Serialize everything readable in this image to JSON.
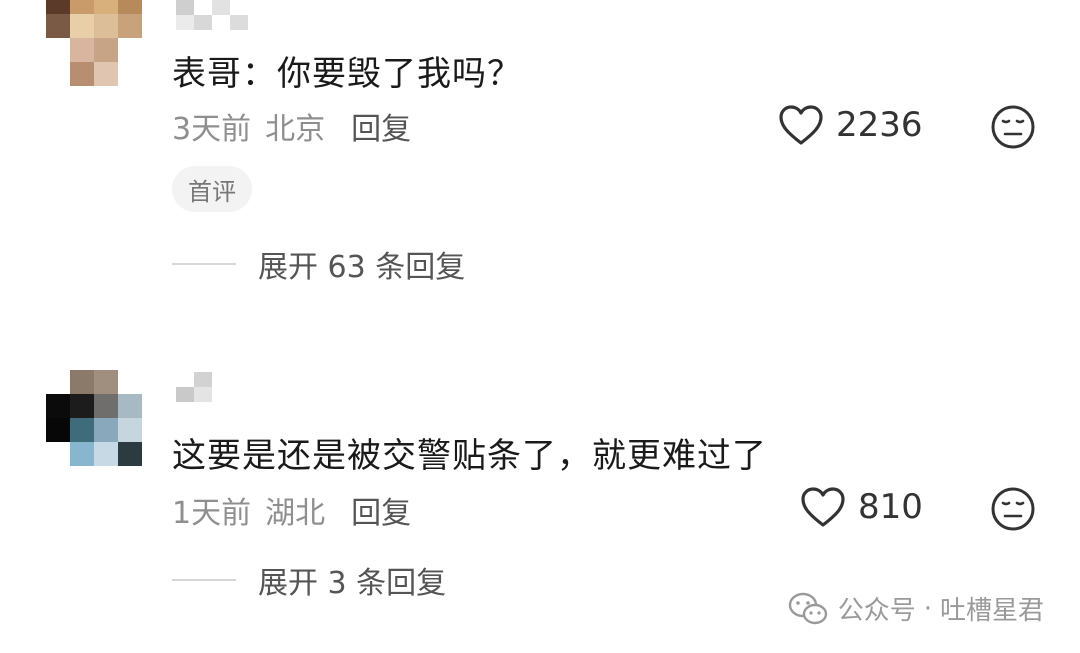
{
  "comments": [
    {
      "text": "表哥：你要毁了我吗？",
      "time": "3天前",
      "location": "北京",
      "reply_label": "回复",
      "likes": "2236",
      "badge": "首评",
      "expand_label": "展开 63 条回复"
    },
    {
      "text": "这要是还是被交警贴条了，就更难过了",
      "time": "1天前",
      "location": "湖北",
      "reply_label": "回复",
      "likes": "810",
      "expand_label": "展开 3 条回复"
    }
  ],
  "watermark": {
    "label": "公众号",
    "separator": "·",
    "account": "吐槽星君"
  },
  "icons": {
    "like": "heart-outline-icon",
    "reaction": "neutral-face-icon",
    "watermark": "wechat-icon"
  },
  "colors": {
    "text": "#1a1a1a",
    "meta": "#8f8f8f",
    "badge_bg": "#f3f3f3"
  }
}
